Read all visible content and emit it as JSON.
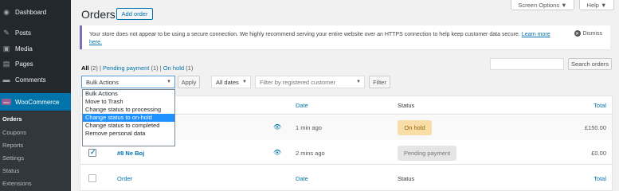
{
  "sidebar": {
    "items": [
      {
        "label": "Dashboard",
        "icon": "dashboard-icon",
        "glyph": "◉"
      },
      {
        "label": "Posts",
        "icon": "pin-icon",
        "glyph": "✎"
      },
      {
        "label": "Media",
        "icon": "media-icon",
        "glyph": "▣"
      },
      {
        "label": "Pages",
        "icon": "page-icon",
        "glyph": "▤"
      },
      {
        "label": "Comments",
        "icon": "comment-icon",
        "glyph": "▬"
      }
    ],
    "woocommerce": {
      "label": "WooCommerce",
      "logo_text": "woo"
    },
    "submenu": [
      "Orders",
      "Coupons",
      "Reports",
      "Settings",
      "Status",
      "Extensions"
    ]
  },
  "header": {
    "title": "Orders",
    "add_order": "Add order",
    "screen_options": "Screen Options ▼",
    "help": "Help ▼"
  },
  "notice": {
    "text": "Your store does not appear to be using a secure connection. We highly recommend serving your entire website over an HTTPS connection to help keep customer data secure.",
    "link": "Learn more here.",
    "dismiss": "Dismiss",
    "border_color": "#826eb4"
  },
  "status_links": {
    "all": "All",
    "all_count": "(2)",
    "pending": "Pending payment",
    "pending_count": "(1)",
    "onhold": "On hold",
    "onhold_count": "(1)"
  },
  "search": {
    "button": "Search orders"
  },
  "filters": {
    "bulk": "Bulk Actions",
    "apply": "Apply",
    "dates": "All dates",
    "customer_placeholder": "Filter by registered customer",
    "filter": "Filter"
  },
  "bulk_options": [
    "Bulk Actions",
    "Move to Trash",
    "Change status to processing",
    "Change status to on-hold",
    "Change status to completed",
    "Remove personal data"
  ],
  "bulk_highlighted": "Change status to on-hold",
  "table": {
    "headers": {
      "order": "Order",
      "date": "Date",
      "status": "Status",
      "total": "Total"
    },
    "rows": [
      {
        "order": "",
        "date": "1 min ago",
        "status": "On hold",
        "total": "£150.00",
        "checked": false
      },
      {
        "order": "#8 Ne Boj",
        "date": "2 mins ago",
        "status": "Pending payment",
        "total": "£0.00",
        "checked": true
      }
    ]
  },
  "colors": {
    "accent": "#0073aa",
    "sidebar_bg": "#23282d",
    "onhold_badge": "#f8dda7",
    "pending_badge": "#e5e5e5"
  }
}
